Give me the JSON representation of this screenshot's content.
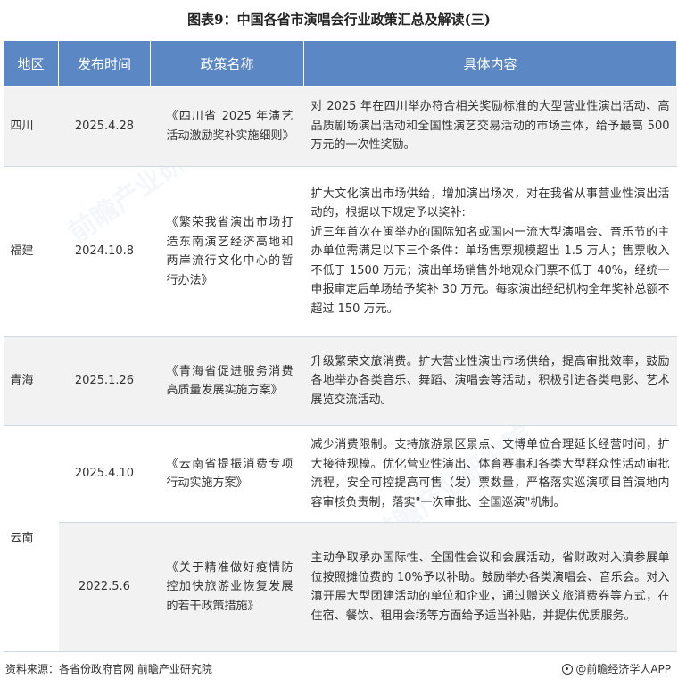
{
  "title": "图表9：中国各省市演唱会行业政策汇总及解读(三)",
  "table": {
    "headers": [
      "地区",
      "发布时间",
      "政策名称",
      "具体内容"
    ],
    "rows": [
      {
        "region": "四川",
        "date": "2025.4.28",
        "name": "《四川省 2025 年演艺活动激励奖补实施细则》",
        "content": [
          "对 2025 年在四川举办符合相关奖励标准的大型营业性演出活动、高品质剧场演出活动和全国性演艺交易活动的市场主体，给予最高 500 万元的一次性奖励。"
        ]
      },
      {
        "region": "福建",
        "date": "2024.10.8",
        "name": "《繁荣我省演出市场打造东南演艺经济高地和两岸流行文化中心的暂行办法》",
        "content": [
          "扩大文化演出市场供给，增加演出场次，对在我省从事营业性演出活动的，根据以下规定予以奖补:",
          "近三年首次在闽举办的国际知名或国内一流大型演唱会、音乐节的主办单位需满足以下三个条件：单场售票规模超出 1.5 万人；售票收入不低于 1500 万元；演出单场销售外地观众门票不低于 40%，经统一申报审定后单场给予奖补 30 万元。每家演出经纪机构全年奖补总额不超过 150 万元。"
        ]
      },
      {
        "region": "青海",
        "date": "2025.1.26",
        "name": "《青海省促进服务消费高质量发展实施方案》",
        "content": [
          "升级繁荣文旅消费。扩大营业性演出市场供给，提高审批效率，鼓励各地举办各类音乐、舞蹈、演唱会等活动，积极引进各类电影、艺术展览交流活动。"
        ]
      },
      {
        "region": "云南",
        "date": "2025.4.10",
        "name": "《云南省提振消费专项行动实施方案》",
        "content": [
          "减少消费限制。支持旅游景区景点、文博单位合理延长经营时间，扩大接待规模。优化营业性演出、体育赛事和各类大型群众性活动审批流程，安全可控提高可售（发）票数量，严格落实巡演项目首演地内容审核负责制，落实\"一次审批、全国巡演\"机制。"
        ]
      },
      {
        "date": "2022.5.6",
        "name": "《关于精准做好疫情防控加快旅游业恢复发展的若干政策措施》",
        "content": [
          "主动争取承办国际性、全国性会议和会展活动，省财政对入滇参展单位按照摊位费的 10%予以补助。鼓励举办各类演唱会、音乐会。对入滇开展大型团建活动的单位和企业，通过赠送文旅消费券等方式，在住宿、餐饮、租用会场等方面给予适当补贴，并提供优质服务。"
        ]
      }
    ]
  },
  "footer": {
    "source": "资料来源：各省份政府官网 前瞻产业研究院",
    "brand": "@前瞻经济学人APP"
  }
}
